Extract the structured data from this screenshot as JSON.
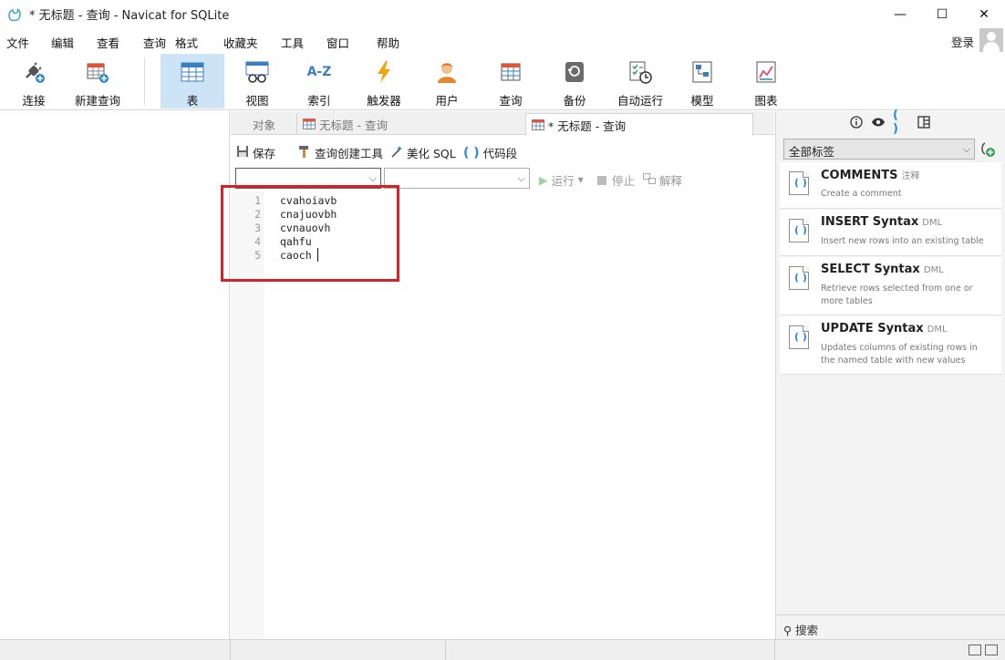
{
  "window": {
    "title": "* 无标题 - 查询 - Navicat for SQLite",
    "minimize": "—",
    "maximize": "☐",
    "close": "✕"
  },
  "menu": {
    "items": [
      "文件",
      "编辑",
      "查看",
      "查询",
      "格式",
      "收藏夹",
      "工具",
      "窗口",
      "帮助"
    ],
    "login": "登录"
  },
  "toolbar": {
    "buttons": [
      {
        "label": "连接",
        "icon": "plug-icon"
      },
      {
        "label": "新建查询",
        "icon": "new-query-icon"
      },
      {
        "label": "表",
        "icon": "table-icon",
        "active": true
      },
      {
        "label": "视图",
        "icon": "view-icon"
      },
      {
        "label": "索引",
        "icon": "index-icon",
        "glyph": "A-Z"
      },
      {
        "label": "触发器",
        "icon": "trigger-icon"
      },
      {
        "label": "用户",
        "icon": "user-icon"
      },
      {
        "label": "查询",
        "icon": "query-icon"
      },
      {
        "label": "备份",
        "icon": "backup-icon"
      },
      {
        "label": "自动运行",
        "icon": "schedule-icon"
      },
      {
        "label": "模型",
        "icon": "model-icon"
      },
      {
        "label": "图表",
        "icon": "chart-icon"
      }
    ]
  },
  "tabs": {
    "objects": "对象",
    "tab1": "无标题 - 查询",
    "tab2": "* 无标题 - 查询"
  },
  "query_tools": {
    "save": "保存",
    "builder": "查询创建工具",
    "beautify": "美化 SQL",
    "snippet": "代码段"
  },
  "run_bar": {
    "run": "运行",
    "stop": "停止",
    "explain": "解释"
  },
  "editor": {
    "lines": [
      {
        "n": "1",
        "text": "cvahoiavb"
      },
      {
        "n": "2",
        "text": "cnajuovbh"
      },
      {
        "n": "3",
        "text": "cvnauovh"
      },
      {
        "n": "4",
        "text": "qahfu"
      },
      {
        "n": "5",
        "text": "caoch"
      }
    ]
  },
  "right_panel": {
    "filter_selected": "全部标签",
    "snippets": [
      {
        "title": "COMMENTS",
        "tag": "注释",
        "desc": "Create a comment"
      },
      {
        "title": "INSERT Syntax",
        "tag": "DML",
        "desc": "Insert new rows into an existing table"
      },
      {
        "title": "SELECT Syntax",
        "tag": "DML",
        "desc": "Retrieve rows selected from one or more tables"
      },
      {
        "title": "UPDATE Syntax",
        "tag": "DML",
        "desc": "Updates columns of existing rows in the named table with new values"
      }
    ],
    "search_label": "搜索"
  },
  "colors": {
    "accent": "#cde4f7",
    "highlight_box": "#d4212a",
    "brand": "#37a9c5"
  }
}
